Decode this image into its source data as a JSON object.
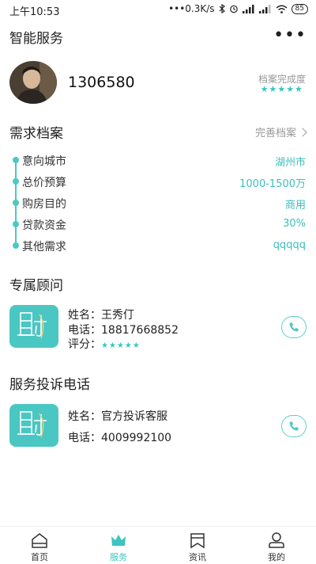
{
  "status": {
    "time": "上午10:53",
    "network": "•••0.3K/s",
    "battery": "85"
  },
  "header": {
    "title": "智能服务",
    "more_icon": "more-dots-icon"
  },
  "profile": {
    "user_id": "1306580",
    "progress_label": "档案完成度",
    "progress_stars": "★★★★★",
    "progress_rating": 5
  },
  "demand": {
    "title": "需求档案",
    "complete_label": "完善档案",
    "items": [
      {
        "label": "意向城市",
        "value": "湖州市"
      },
      {
        "label": "总价预算",
        "value": "1000-1500万"
      },
      {
        "label": "购房目的",
        "value": "商用"
      },
      {
        "label": "贷款资金",
        "value": "30%"
      },
      {
        "label": "其他需求",
        "value": "qqqqq"
      }
    ]
  },
  "advisor": {
    "title": "专属顾问",
    "name_line": "姓名：王秀仃",
    "phone_line": "电话：18817668852",
    "rating_label": "评分：",
    "rating_stars": "★★★★★",
    "rating": 5
  },
  "complaint": {
    "title": "服务投诉电话",
    "name_line": "姓名：官方投诉客服",
    "phone_line": "电话：4009992100"
  },
  "tabs": [
    {
      "label": "首页",
      "icon": "home-icon"
    },
    {
      "label": "服务",
      "icon": "crown-icon",
      "active": true
    },
    {
      "label": "资讯",
      "icon": "bookmark-icon"
    },
    {
      "label": "我的",
      "icon": "user-icon"
    }
  ],
  "colors": {
    "accent": "#3cc4c0",
    "text": "#222222",
    "muted": "#999999"
  }
}
